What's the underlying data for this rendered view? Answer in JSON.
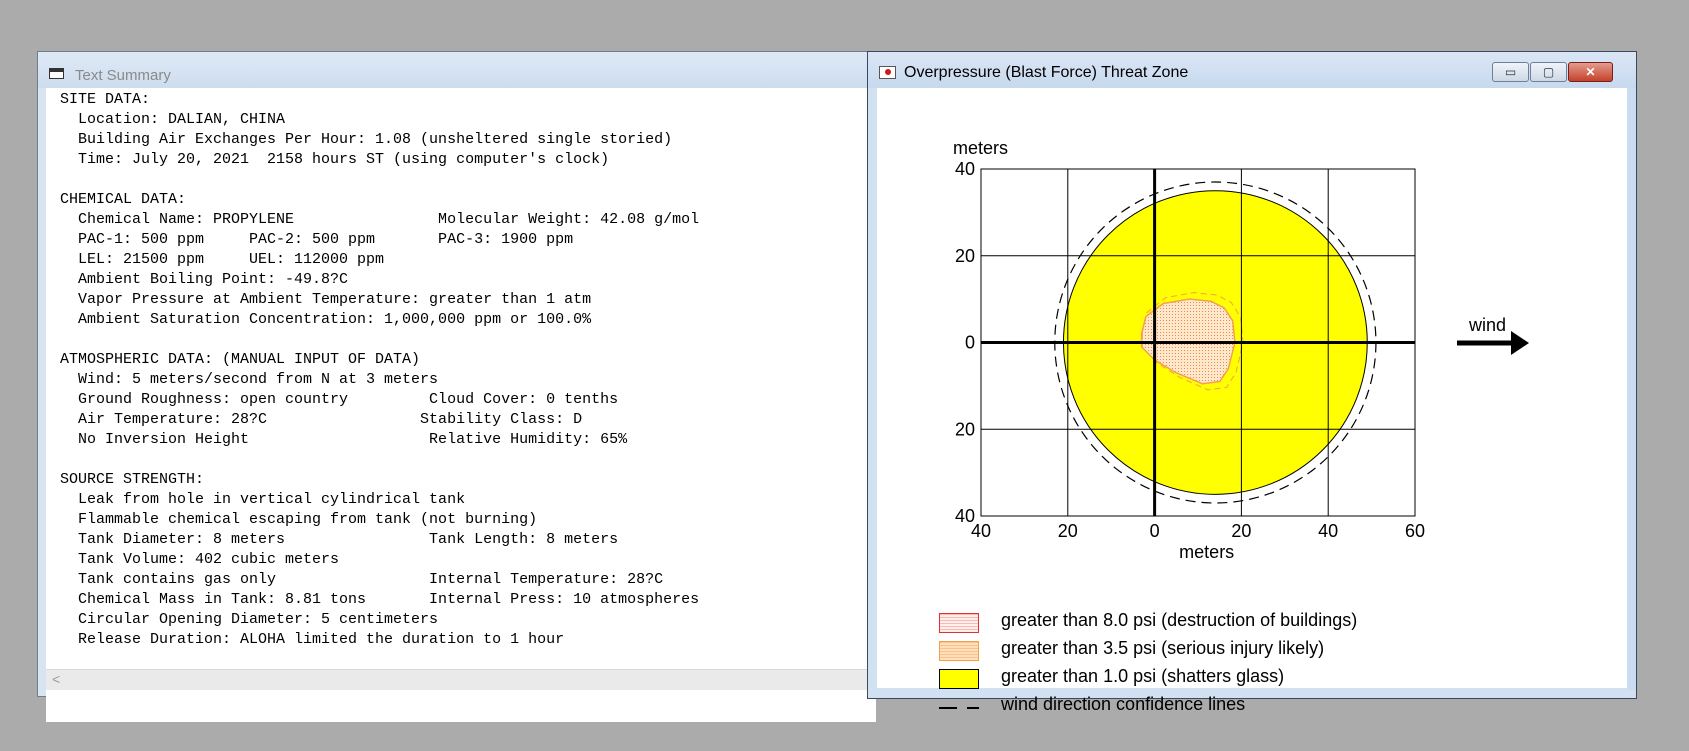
{
  "text_window": {
    "title": "Text Summary",
    "summary_lines": [
      "SITE DATA:",
      "  Location: DALIAN, CHINA",
      "  Building Air Exchanges Per Hour: 1.08 (unsheltered single storied)",
      "  Time: July 20, 2021  2158 hours ST (using computer's clock)",
      "",
      "CHEMICAL DATA:",
      "  Chemical Name: PROPYLENE                Molecular Weight: 42.08 g/mol",
      "  PAC-1: 500 ppm     PAC-2: 500 ppm       PAC-3: 1900 ppm",
      "  LEL: 21500 ppm     UEL: 112000 ppm",
      "  Ambient Boiling Point: -49.8?C",
      "  Vapor Pressure at Ambient Temperature: greater than 1 atm",
      "  Ambient Saturation Concentration: 1,000,000 ppm or 100.0%",
      "",
      "ATMOSPHERIC DATA: (MANUAL INPUT OF DATA)",
      "  Wind: 5 meters/second from N at 3 meters",
      "  Ground Roughness: open country         Cloud Cover: 0 tenths",
      "  Air Temperature: 28?C                 Stability Class: D",
      "  No Inversion Height                    Relative Humidity: 65%",
      "",
      "SOURCE STRENGTH:",
      "  Leak from hole in vertical cylindrical tank",
      "  Flammable chemical escaping from tank (not burning)",
      "  Tank Diameter: 8 meters                Tank Length: 8 meters",
      "  Tank Volume: 402 cubic meters",
      "  Tank contains gas only                 Internal Temperature: 28?C",
      "  Chemical Mass in Tank: 8.81 tons       Internal Press: 10 atmospheres",
      "  Circular Opening Diameter: 5 centimeters",
      "  Release Duration: ALOHA limited the duration to 1 hour"
    ],
    "scroll_left_glyph": "<"
  },
  "threat_window": {
    "title": "Overpressure (Blast Force) Threat Zone",
    "controls": {
      "minimize": "▭",
      "maximize": "▢",
      "close": "✕"
    }
  },
  "chart_data": {
    "type": "map",
    "y_unit_label": "meters",
    "xlabel": "meters",
    "x_ticks": [
      "40",
      "20",
      "0",
      "20",
      "40",
      "60"
    ],
    "y_ticks": [
      "40",
      "20",
      "0",
      "20",
      "40"
    ],
    "xlim": [
      -40,
      60
    ],
    "ylim": [
      -40,
      40
    ],
    "grid": true,
    "wind_label": "wind",
    "zones": [
      {
        "threshold": "greater than 8.0 psi",
        "meaning": "destruction of buildings",
        "color": "#ff4040",
        "extent": "none"
      },
      {
        "threshold": "greater than 3.5 psi",
        "meaning": "serious injury likely",
        "color": "#f5a050",
        "outline": [
          [
            -3,
            2
          ],
          [
            -2,
            6
          ],
          [
            2,
            9
          ],
          [
            8,
            10
          ],
          [
            13,
            9.5
          ],
          [
            16,
            8
          ],
          [
            18,
            5
          ],
          [
            18.5,
            0
          ],
          [
            17,
            -6
          ],
          [
            15,
            -9
          ],
          [
            11,
            -9.5
          ],
          [
            5,
            -7
          ],
          [
            0,
            -4
          ],
          [
            -3,
            -1
          ]
        ]
      },
      {
        "threshold": "greater than 1.0 psi",
        "meaning": "shatters glass",
        "color": "#ffff00",
        "center": [
          14,
          0
        ],
        "radius": 35
      }
    ],
    "confidence_circle": {
      "center": [
        14,
        0
      ],
      "radius": 37
    },
    "legend": [
      {
        "swatch": "red-dotted",
        "label": "greater than 8.0 psi (destruction of buildings)"
      },
      {
        "swatch": "orange-dotted",
        "label": "greater than 3.5 psi (serious injury likely)"
      },
      {
        "swatch": "yellow",
        "label": "greater than 1.0 psi (shatters glass)"
      },
      {
        "swatch": "dashed-line",
        "label": "wind direction confidence lines"
      }
    ]
  }
}
